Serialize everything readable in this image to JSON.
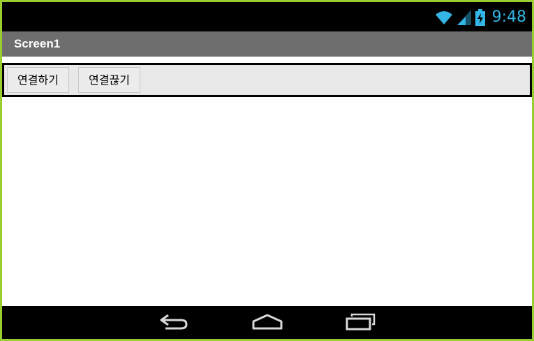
{
  "status_bar": {
    "time": "9:48",
    "icons": [
      "wifi-icon",
      "signal-icon",
      "battery-charging-icon"
    ],
    "accent_color": "#33b5e5"
  },
  "title_bar": {
    "title": "Screen1"
  },
  "buttons": {
    "connect_label": "연결하기",
    "disconnect_label": "연결끊기"
  },
  "nav_bar": {
    "icons": [
      "back-icon",
      "home-icon",
      "recents-icon"
    ]
  },
  "colors": {
    "frame_border": "#9acd32",
    "title_bar_bg": "#6e6e6e",
    "button_row_bg": "#e8e8e8"
  }
}
